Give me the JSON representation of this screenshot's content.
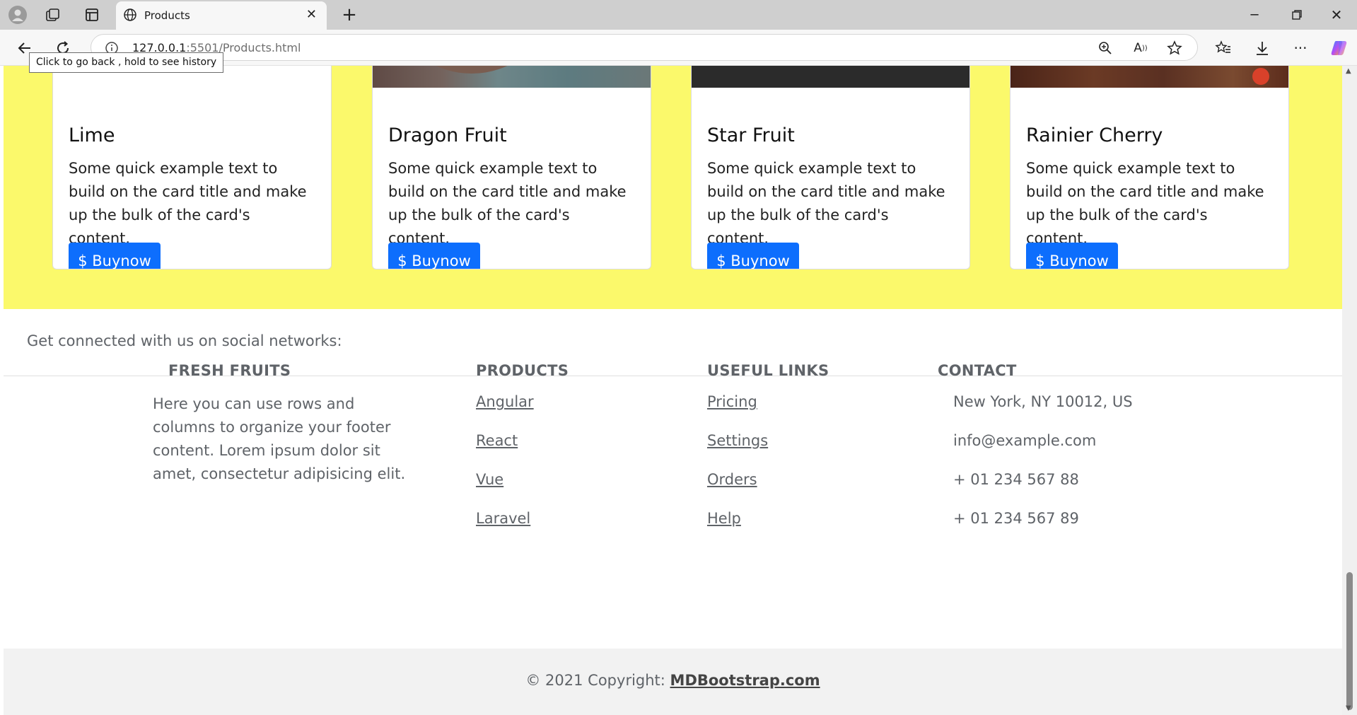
{
  "browser": {
    "tab_title": "Products",
    "url_host": "127.0.0.1",
    "url_rest": ":5501/Products.html",
    "tooltip": "Click to go back , hold to see history",
    "icons": [
      "profile-icon",
      "workspaces-icon",
      "tab-actions-icon",
      "globe-icon",
      "close-icon",
      "new-tab-icon",
      "minimize-icon",
      "restore-icon",
      "window-close-icon",
      "back-icon",
      "refresh-icon",
      "info-icon",
      "zoom-icon",
      "read-aloud-icon",
      "favorite-icon",
      "favorites-icon",
      "downloads-icon",
      "more-icon",
      "copilot-icon"
    ]
  },
  "products": [
    {
      "title": "Lime",
      "text": "Some quick example text to build on the card title and make up the bulk of the card's content.",
      "button": "$ Buynow"
    },
    {
      "title": "Dragon Fruit",
      "text": "Some quick example text to build on the card title and make up the bulk of the card's content.",
      "button": "$ Buynow"
    },
    {
      "title": "Star Fruit",
      "text": "Some quick example text to build on the card title and make up the bulk of the card's content.",
      "button": "$ Buynow"
    },
    {
      "title": "Rainier Cherry",
      "text": "Some quick example text to build on the card title and make up the bulk of the card's content.",
      "button": "$ Buynow"
    }
  ],
  "social": {
    "text": "Get connected with us on social networks:"
  },
  "footer": {
    "fresh": {
      "title": "FRESH FRUITS",
      "text": "Here you can use rows and columns to organize your footer content. Lorem ipsum dolor sit amet, consectetur adipisicing elit."
    },
    "products": {
      "title": "PRODUCTS",
      "links": [
        "Angular",
        "React",
        "Vue",
        "Laravel"
      ]
    },
    "useful": {
      "title": "USEFUL LINKS",
      "links": [
        "Pricing",
        "Settings",
        "Orders",
        "Help"
      ]
    },
    "contact": {
      "title": "CONTACT",
      "items": [
        "New York, NY 10012, US",
        "info@example.com",
        "+ 01 234 567 88",
        "+ 01 234 567 89"
      ]
    }
  },
  "copyright": {
    "prefix": "© 2021 Copyright:",
    "brand": "MDBootstrap.com"
  },
  "colors": {
    "section_bg": "#fbf96b",
    "button": "#0d6efd"
  }
}
